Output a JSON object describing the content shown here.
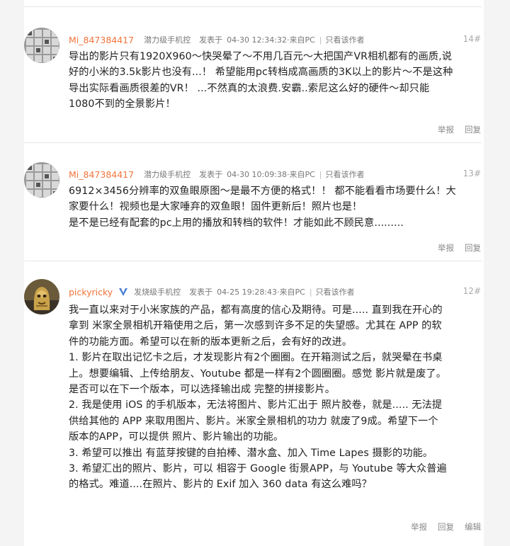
{
  "posts": [
    {
      "username": "Mi_847384417",
      "level": "潜力级手机控",
      "posted_label": "发表于",
      "time": "04-30 12:34:32",
      "source": "·来自PC",
      "author_only": "只看该作者",
      "floor": "14#",
      "lines": [
        "导出的影片只有1920X960～快哭晕了～不用几百元～大把国产VR相机都有的画质,说",
        "好的小米的3.5k影片也没有...！ 希望能用pc转档成高画质的3K以上的影片～不是这种",
        "导出实际看画质很差的VR！ ...不然真的太浪费.安霸..索尼这么好的硬件～却只能",
        "1080不到的全景影片！"
      ],
      "actions": [
        "举报",
        "回复"
      ]
    },
    {
      "username": "Mi_847384417",
      "level": "潜力级手机控",
      "posted_label": "发表于",
      "time": "04-30 10:09:38",
      "source": "·来自PC",
      "author_only": "只看该作者",
      "floor": "13#",
      "lines": [
        "6912×3456分辨率的双鱼眼原图～是最不方便的格式！！ 都不能看看市场要什么！大",
        "家要什么！视频也是大家唾弃的双鱼眼！固件更新后！照片也是！",
        "是不是已经有配套的pc上用的播放和转档的软件！才能如此不顾民意........."
      ],
      "actions": [
        "举报",
        "回复"
      ]
    },
    {
      "username": "pickyricky",
      "level": "发烧级手机控",
      "posted_label": "发表于",
      "time": "04-25 19:28:43",
      "source": "·来自PC",
      "author_only": "只看该作者",
      "floor": "12#",
      "lines": [
        "我一直以来对于小米家族的产品，都有高度的信心及期待。可是..... 直到我在开心的",
        "拿到 米家全景相机开箱使用之后，第一次感到许多不足的失望感。尤其在 APP 的软",
        "件的功能方面。希望可以在新的版本更新之后，会有好的改进。",
        "1. 影片在取出记忆卡之后，才发现影片有2个圈圈。在开箱测试之后，就哭晕在书桌",
        "上。想要编辑、上传给朋友、Youtube 都是一样有2个圆圈圈。感觉 影片就是废了。",
        "是否可以在下一个版本，可以选择输出成 完整的拼接影片。",
        "2. 我是使用 iOS 的手机版本，无法将图片、影片汇出于 照片胶卷，就是..... 无法提",
        "供给其他的 APP 来取用图片、影片。米家全景相机的功力 就废了9成。希望下一个",
        "版本的APP，可以提供 照片、影片输出的功能。",
        "3. 希望可以推出 有蓝芽按键的自拍棒、潜水盒、加入 Time Lapes 摄影的功能。",
        "3. 希望汇出的照片、影片，可以 相容于 Google 街景APP，与 Youtube 等大众普遍",
        "的格式。难道....在照片、影片的 Exif 加入 360 data 有这么难吗？"
      ],
      "actions": [
        "举报",
        "回复",
        "编辑"
      ]
    }
  ],
  "colors": {
    "username": "#f0743c",
    "vip_badge": "#4a7fd6"
  }
}
